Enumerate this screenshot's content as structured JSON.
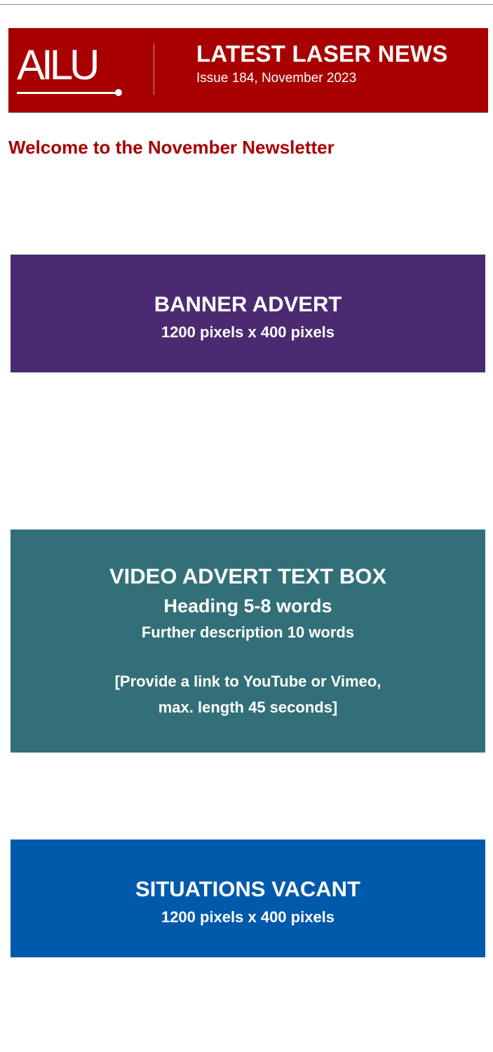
{
  "header": {
    "logo_text": "AILU",
    "title": "LATEST LASER NEWS",
    "issue": "Issue 184, November 2023",
    "background_color": "#a80000"
  },
  "welcome": {
    "heading": "Welcome to the November Newsletter",
    "color": "#a80000"
  },
  "banner_advert": {
    "title": "BANNER ADVERT",
    "size": "1200 pixels x 400 pixels",
    "color": "#4b2a72"
  },
  "video_advert": {
    "title": "VIDEO ADVERT TEXT BOX",
    "heading": "Heading 5-8 words",
    "description": "Further description 10 words",
    "instruction_line1": "[Provide a link to YouTube or Vimeo,",
    "instruction_line2": "max. length 45 seconds]",
    "color": "#336f78"
  },
  "situations_vacant": {
    "title": "SITUATIONS VACANT",
    "size": "1200 pixels x 400 pixels",
    "color": "#005aab"
  }
}
